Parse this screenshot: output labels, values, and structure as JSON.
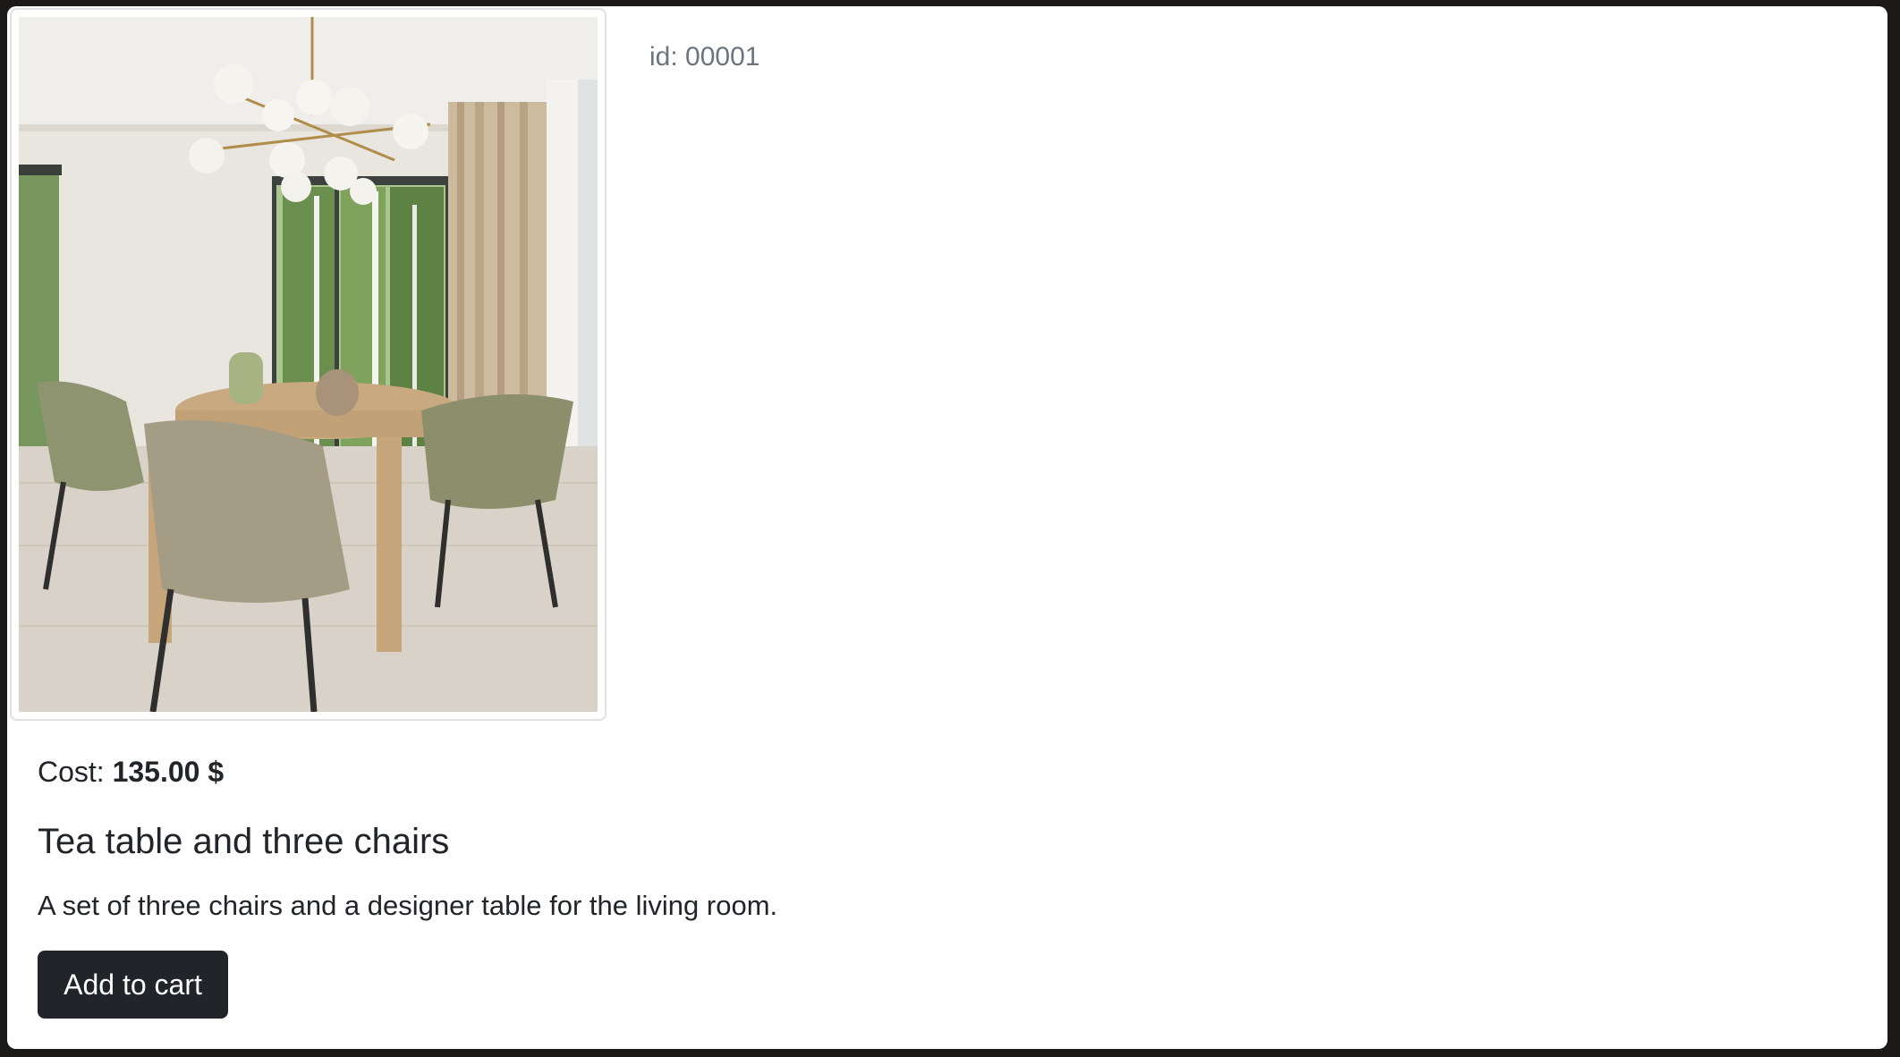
{
  "product": {
    "id_label": "id: 00001",
    "cost_label": "Cost:",
    "cost_value": "135.00 $",
    "title": "Tea table and three chairs",
    "description": "A set of three chairs and a designer table for the living room.",
    "add_to_cart_label": "Add to cart",
    "image_subject": "dining-room-table-and-chairs-photo"
  },
  "colors": {
    "button_bg": "#212529",
    "button_text": "#ffffff",
    "muted_text": "#6c757d",
    "text": "#212529",
    "border": "#dee2e6"
  }
}
